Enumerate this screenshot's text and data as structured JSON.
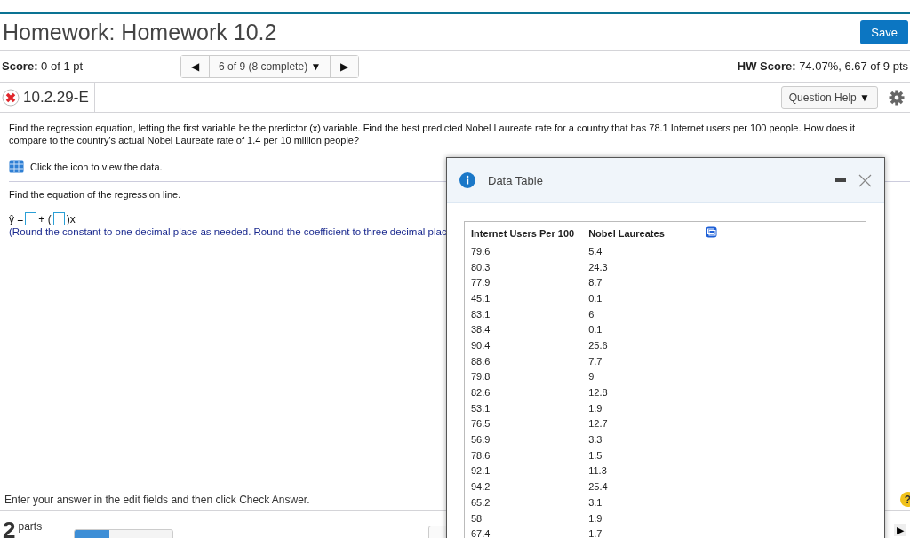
{
  "title": "Homework: Homework 10.2",
  "save_button": "Save",
  "score": {
    "label": "Score:",
    "value": "0 of 1 pt"
  },
  "navigator": {
    "prev": "◀",
    "current": "6 of 9 (8 complete)",
    "caret": "▼",
    "next": "▶"
  },
  "hw_score": {
    "label": "HW Score:",
    "value": "74.07%, 6.67 of 9 pts"
  },
  "question": {
    "id": "10.2.29-E",
    "correct": false,
    "help_button": "Question Help",
    "help_caret": "▼"
  },
  "question_text": "Find the regression equation, letting the first variable be the predictor (x) variable. Find the best predicted Nobel Laureate rate for a country that has 78.1 Internet users per 100 people. How does it compare to the country's actual Nobel Laureate rate of 1.4 per 10 million people?",
  "data_link": "Click the icon to view the data.",
  "prompt": "Find the equation of the regression line.",
  "equation": {
    "lhs": "ŷ =",
    "plus": "+ (",
    "suffix": ")x"
  },
  "rounding_note": "(Round the constant to one decimal place as needed. Round the coefficient to three decimal plac",
  "footer_hint": "Enter your answer in the edit fields and then click Check Answer.",
  "help_mark": "?",
  "parts": {
    "number": "2",
    "label": "parts",
    "level": 0.35
  },
  "next_arrow": "▶",
  "dialog": {
    "title": "Data Table",
    "columns": [
      "Internet Users Per 100",
      "Nobel Laureates"
    ],
    "rows": [
      [
        "79.6",
        "5.4"
      ],
      [
        "80.3",
        "24.3"
      ],
      [
        "77.9",
        "8.7"
      ],
      [
        "45.1",
        "0.1"
      ],
      [
        "83.1",
        "6"
      ],
      [
        "38.4",
        "0.1"
      ],
      [
        "90.4",
        "25.6"
      ],
      [
        "88.6",
        "7.7"
      ],
      [
        "79.8",
        "9"
      ],
      [
        "82.6",
        "12.8"
      ],
      [
        "53.1",
        "1.9"
      ],
      [
        "76.5",
        "12.7"
      ],
      [
        "56.9",
        "3.3"
      ],
      [
        "78.6",
        "1.5"
      ],
      [
        "92.1",
        "11.3"
      ],
      [
        "94.2",
        "25.4"
      ],
      [
        "65.2",
        "3.1"
      ],
      [
        "58",
        "1.9"
      ],
      [
        "67.4",
        "1.7"
      ]
    ]
  }
}
